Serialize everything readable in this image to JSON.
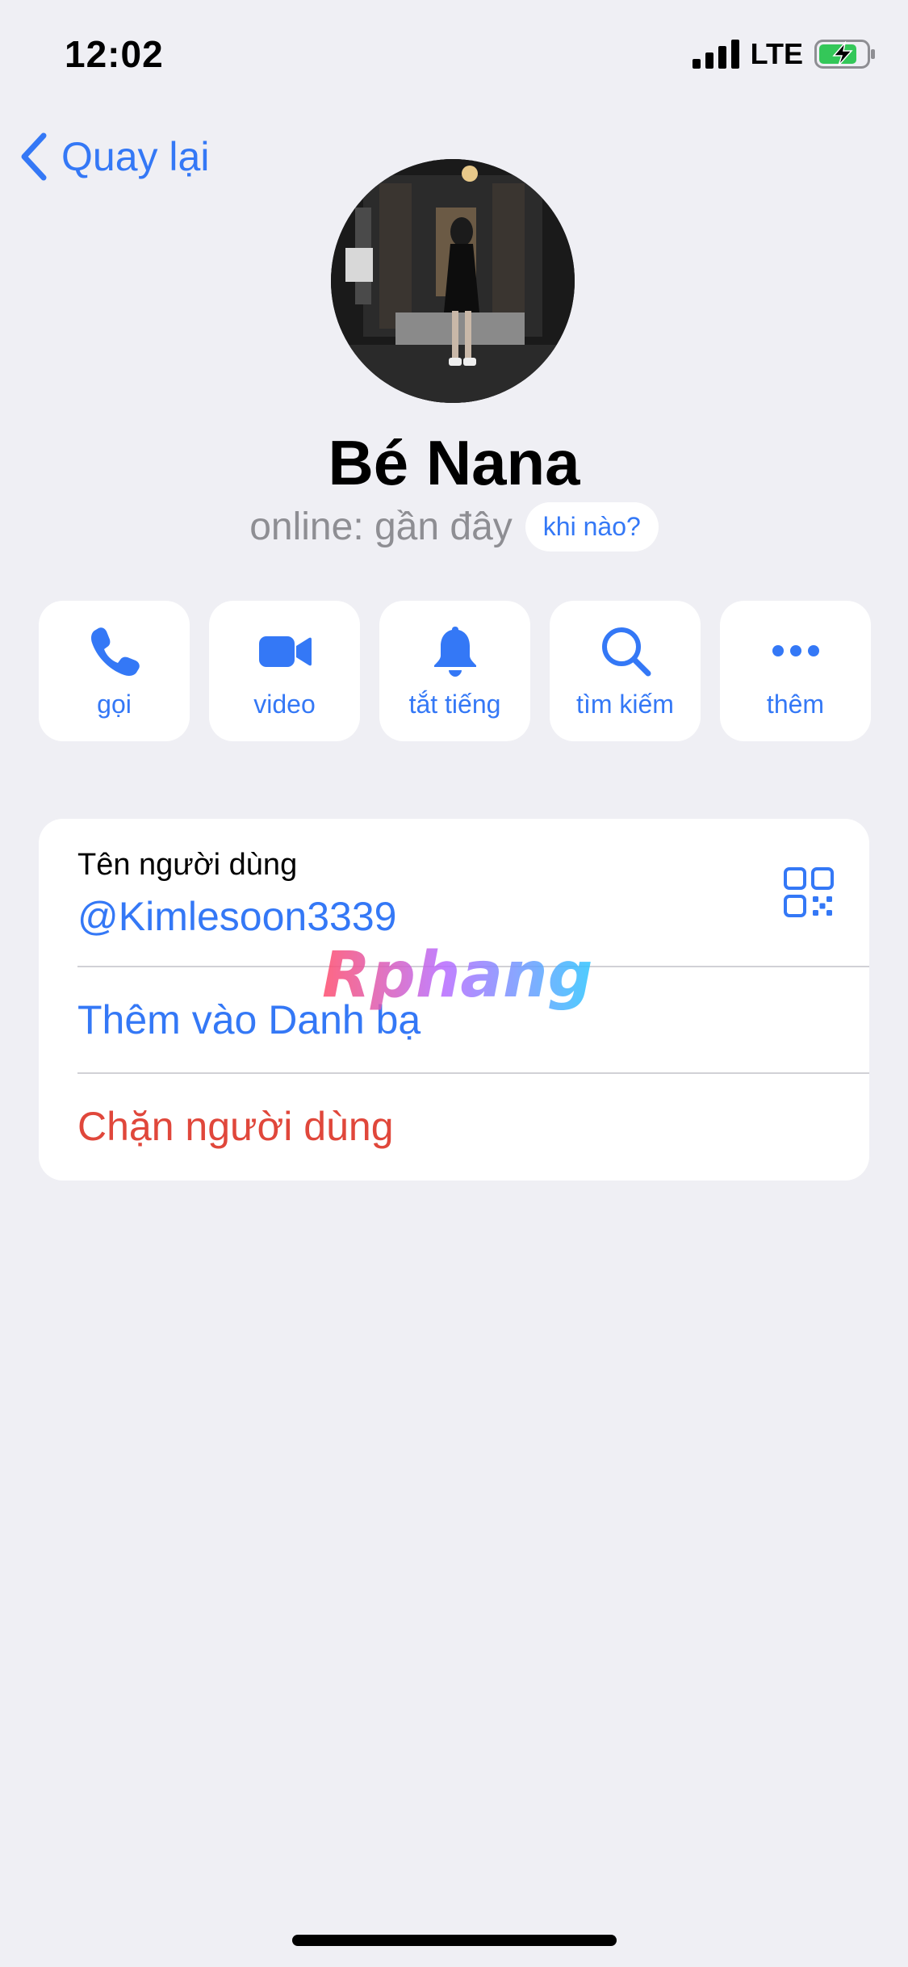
{
  "status_bar": {
    "time": "12:02",
    "network": "LTE",
    "icons": [
      "signal-icon",
      "battery-charging-icon"
    ]
  },
  "nav": {
    "back_label": "Quay lại",
    "back_icon": "chevron-left-icon"
  },
  "profile": {
    "name": "Bé Nana",
    "presence": "online: gần đây",
    "when_chip": "khi nào?"
  },
  "actions": [
    {
      "label": "gọi",
      "icon": "phone-icon"
    },
    {
      "label": "video",
      "icon": "video-camera-icon"
    },
    {
      "label": "tắt tiếng",
      "icon": "bell-icon"
    },
    {
      "label": "tìm kiếm",
      "icon": "search-icon"
    },
    {
      "label": "thêm",
      "icon": "more-icon"
    }
  ],
  "info": {
    "username_caption": "Tên người dùng",
    "username_value": "@Kimlesoon3339",
    "qr_icon": "qr-code-icon",
    "add_contact": "Thêm vào Danh bạ",
    "block_user": "Chặn người dùng"
  },
  "watermark": {
    "text": "Rphang"
  },
  "colors": {
    "accent": "#3478f6",
    "destructive": "#e0473b",
    "background": "#efeff4",
    "card": "#ffffff",
    "secondary_text": "#8e8e93"
  }
}
